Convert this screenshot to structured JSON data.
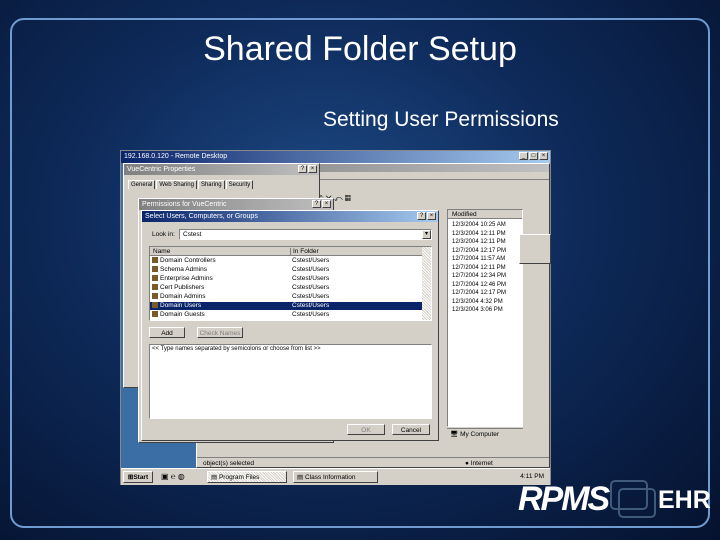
{
  "slide": {
    "title": "Shared Folder Setup",
    "subtitle": "Setting User Permissions"
  },
  "remote_desktop": {
    "title": "192.168.0.120 - Remote Desktop"
  },
  "properties": {
    "title": "VueCentric Properties",
    "tabs": [
      "General",
      "Web Sharing",
      "Sharing",
      "Security"
    ]
  },
  "permissions": {
    "title": "Permissions for VueCentric"
  },
  "select_users": {
    "title": "Select Users, Computers, or Groups",
    "look_in_label": "Look in:",
    "look_in_value": "Cstest",
    "columns": [
      "Name",
      "In Folder"
    ],
    "rows": [
      {
        "name": "Domain Controllers",
        "folder": "Cstest/Users"
      },
      {
        "name": "Schema Admins",
        "folder": "Cstest/Users"
      },
      {
        "name": "Enterprise Admins",
        "folder": "Cstest/Users"
      },
      {
        "name": "Cert Publishers",
        "folder": "Cstest/Users"
      },
      {
        "name": "Domain Admins",
        "folder": "Cstest/Users"
      },
      {
        "name": "Domain Users",
        "folder": "Cstest/Users"
      },
      {
        "name": "Domain Guests",
        "folder": "Cstest/Users"
      }
    ],
    "selected_index": 5,
    "add_button": "Add",
    "check_names_button": "Check Names",
    "names_text": "<< Type names separated by semicolons or choose from list >>",
    "ok_button": "OK",
    "cancel_button": "Cancel"
  },
  "explorer": {
    "modified_header": "Modified",
    "modified": [
      "12/3/2004 10:25 AM",
      "12/3/2004 12:11 PM",
      "12/3/2004 12:11 PM",
      "12/7/2004 12:17 PM",
      "12/7/2004 11:57 AM",
      "12/7/2004 12:11 PM",
      "12/7/2004 12:34 PM",
      "12/7/2004 12:46 PM",
      "12/7/2004 12:17 PM",
      "12/3/2004 4:32 PM",
      "12/3/2004 3:06 PM"
    ],
    "my_computer": "My Computer",
    "status": "object(s) selected",
    "internet": "Internet"
  },
  "taskbar": {
    "start": "Start",
    "tasks": [
      "Program Files",
      "Class Information"
    ],
    "clock": "4:11 PM"
  },
  "logo": {
    "text": "RPMS",
    "suffix": "EHR"
  }
}
